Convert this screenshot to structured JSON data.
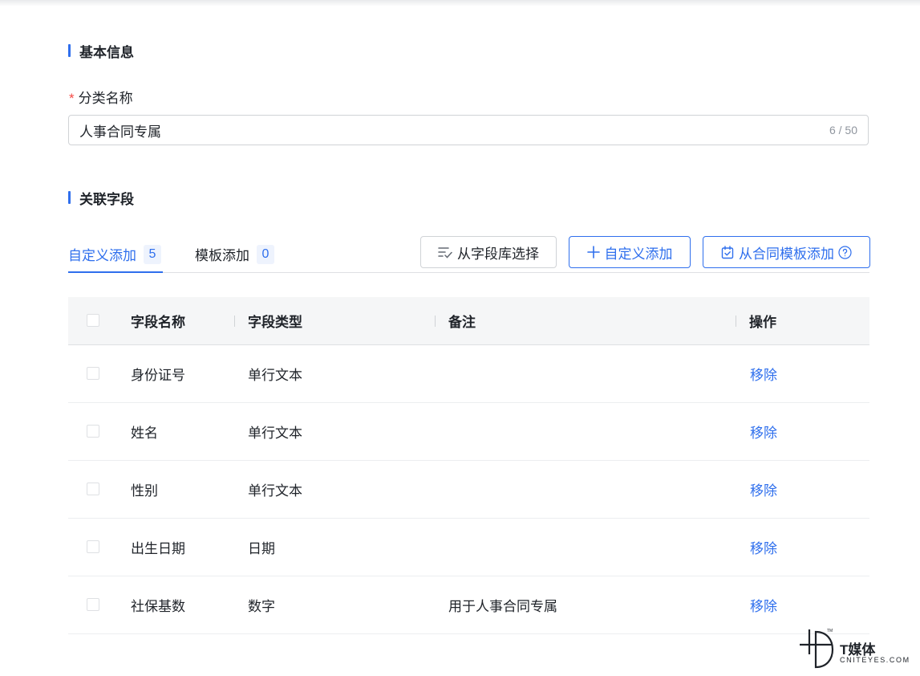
{
  "basic_section": {
    "title": "基本信息"
  },
  "category_field": {
    "required_mark": "*",
    "label": "分类名称",
    "value": "人事合同专属",
    "counter": "6 / 50"
  },
  "fields_section": {
    "title": "关联字段"
  },
  "tabs": [
    {
      "label": "自定义添加",
      "count": "5",
      "active": true
    },
    {
      "label": "模板添加",
      "count": "0",
      "active": false
    }
  ],
  "actions": {
    "from_library": "从字段库选择",
    "custom_add": "自定义添加",
    "from_template": "从合同模板添加"
  },
  "icons": {
    "from_library": "list-check-icon",
    "custom_add": "plus-icon",
    "from_template": "calendar-check-icon",
    "help": "question-circle-icon"
  },
  "table": {
    "columns": [
      "字段名称",
      "字段类型",
      "备注",
      "操作"
    ],
    "rows": [
      {
        "name": "身份证号",
        "type": "单行文本",
        "note": "",
        "action": "移除"
      },
      {
        "name": "姓名",
        "type": "单行文本",
        "note": "",
        "action": "移除"
      },
      {
        "name": "性别",
        "type": "单行文本",
        "note": "",
        "action": "移除"
      },
      {
        "name": "出生日期",
        "type": "日期",
        "note": "",
        "action": "移除"
      },
      {
        "name": "社保基数",
        "type": "数字",
        "note": "用于人事合同专属",
        "action": "移除"
      }
    ]
  },
  "watermark": {
    "name": "T媒体",
    "domain": "CNITEYES.COM",
    "tm": "TM"
  },
  "colors": {
    "accent": "#2f6fed",
    "required": "#f54a45",
    "header_bg": "#f5f6f7"
  }
}
